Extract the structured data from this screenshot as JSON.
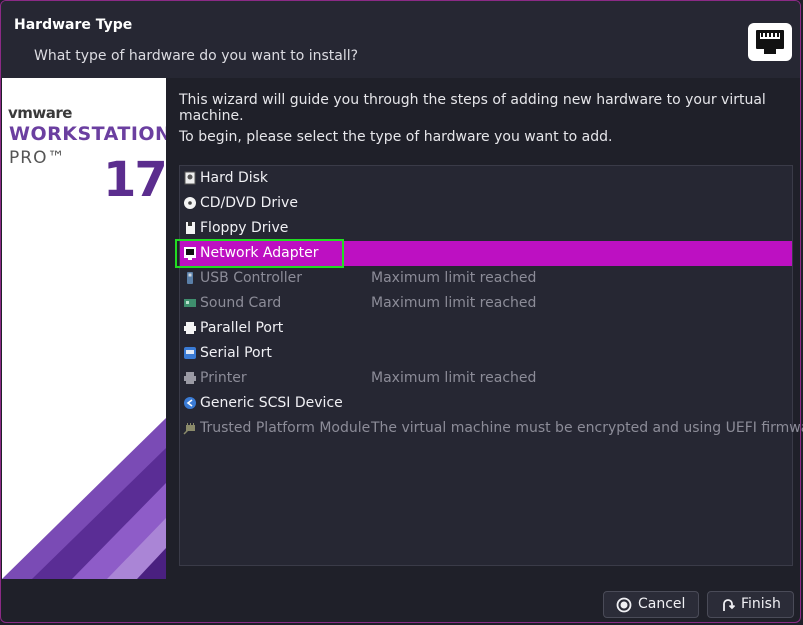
{
  "dialog": {
    "title": "Hardware Type",
    "subtitle": "What type of hardware do you want to install?",
    "header_icon": "network-adapter-icon"
  },
  "branding": {
    "logo": "vmware",
    "product": "WORKSTATION",
    "edition": "PRO™",
    "version": "17"
  },
  "intro": {
    "line1": "This wizard will guide you through the steps of adding new hardware to your virtual machine.",
    "line2": "To begin, please select the type of hardware you want to add."
  },
  "hardware_list": [
    {
      "label": "Hard Disk",
      "note": "",
      "icon": "hard-disk-icon",
      "enabled": true,
      "selected": false
    },
    {
      "label": "CD/DVD Drive",
      "note": "",
      "icon": "cd-dvd-icon",
      "enabled": true,
      "selected": false
    },
    {
      "label": "Floppy Drive",
      "note": "",
      "icon": "floppy-icon",
      "enabled": true,
      "selected": false
    },
    {
      "label": "Network Adapter",
      "note": "",
      "icon": "network-adapter-icon",
      "enabled": true,
      "selected": true
    },
    {
      "label": "USB Controller",
      "note": "Maximum limit reached",
      "icon": "usb-icon",
      "enabled": false,
      "selected": false
    },
    {
      "label": "Sound Card",
      "note": "Maximum limit reached",
      "icon": "sound-card-icon",
      "enabled": false,
      "selected": false
    },
    {
      "label": "Parallel Port",
      "note": "",
      "icon": "parallel-port-icon",
      "enabled": true,
      "selected": false
    },
    {
      "label": "Serial Port",
      "note": "",
      "icon": "serial-port-icon",
      "enabled": true,
      "selected": false
    },
    {
      "label": "Printer",
      "note": "Maximum limit reached",
      "icon": "printer-icon",
      "enabled": false,
      "selected": false
    },
    {
      "label": "Generic SCSI Device",
      "note": "",
      "icon": "scsi-icon",
      "enabled": true,
      "selected": false
    },
    {
      "label": "Trusted Platform Module",
      "note": "The virtual machine must be encrypted and using UEFI firmware.",
      "icon": "tpm-icon",
      "enabled": false,
      "selected": false
    }
  ],
  "buttons": {
    "cancel": "Cancel",
    "finish": "Finish"
  },
  "colors": {
    "selection": "#bd10c2",
    "focus_outline": "#22dd22",
    "window_border": "#8b2a86",
    "brand_purple": "#5b2d8e"
  }
}
